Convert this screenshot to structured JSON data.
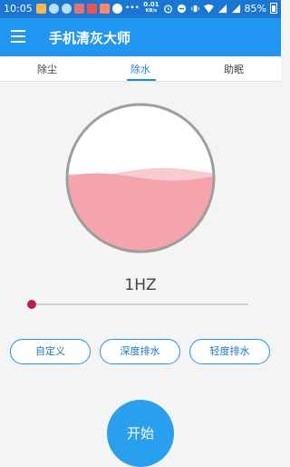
{
  "status_bar": {
    "time": "10:05",
    "notifications": [
      {
        "icon": "weibo-icon",
        "color": "#ffb74d"
      },
      {
        "icon": "settings-gear-icon",
        "color": "#bbdefb"
      },
      {
        "icon": "settings-gear-icon",
        "color": "#bbdefb"
      },
      {
        "icon": "news-icon",
        "color": "#e57373"
      },
      {
        "icon": "news-icon",
        "color": "#ef5350"
      },
      {
        "icon": "game-icon",
        "color": "#ff8a65"
      },
      {
        "icon": "app-icon",
        "color": "#ffffff"
      },
      {
        "icon": "more-dots-icon",
        "color": "#ffffff"
      }
    ],
    "net_speed_value": "0.01",
    "net_speed_unit": "KB/s",
    "battery": "85%"
  },
  "app_bar": {
    "title": "手机清灰大师"
  },
  "tabs": [
    {
      "label": "除尘",
      "active": false
    },
    {
      "label": "除水",
      "active": true
    },
    {
      "label": "助眠",
      "active": false
    }
  ],
  "gauge": {
    "fill_fraction": 0.52,
    "fill_color": "#f4a4aa",
    "wave_color": "#f8cbd0",
    "ring_color": "#9e9e9e"
  },
  "frequency": {
    "label": "1HZ",
    "slider_value": 1
  },
  "modes": [
    {
      "label": "自定义"
    },
    {
      "label": "深度排水"
    },
    {
      "label": "轻度排水"
    }
  ],
  "start_button": {
    "label": "开始"
  },
  "colors": {
    "primary": "#2196f3",
    "status_bar": "#1976d2",
    "accent": "#c2185b"
  }
}
